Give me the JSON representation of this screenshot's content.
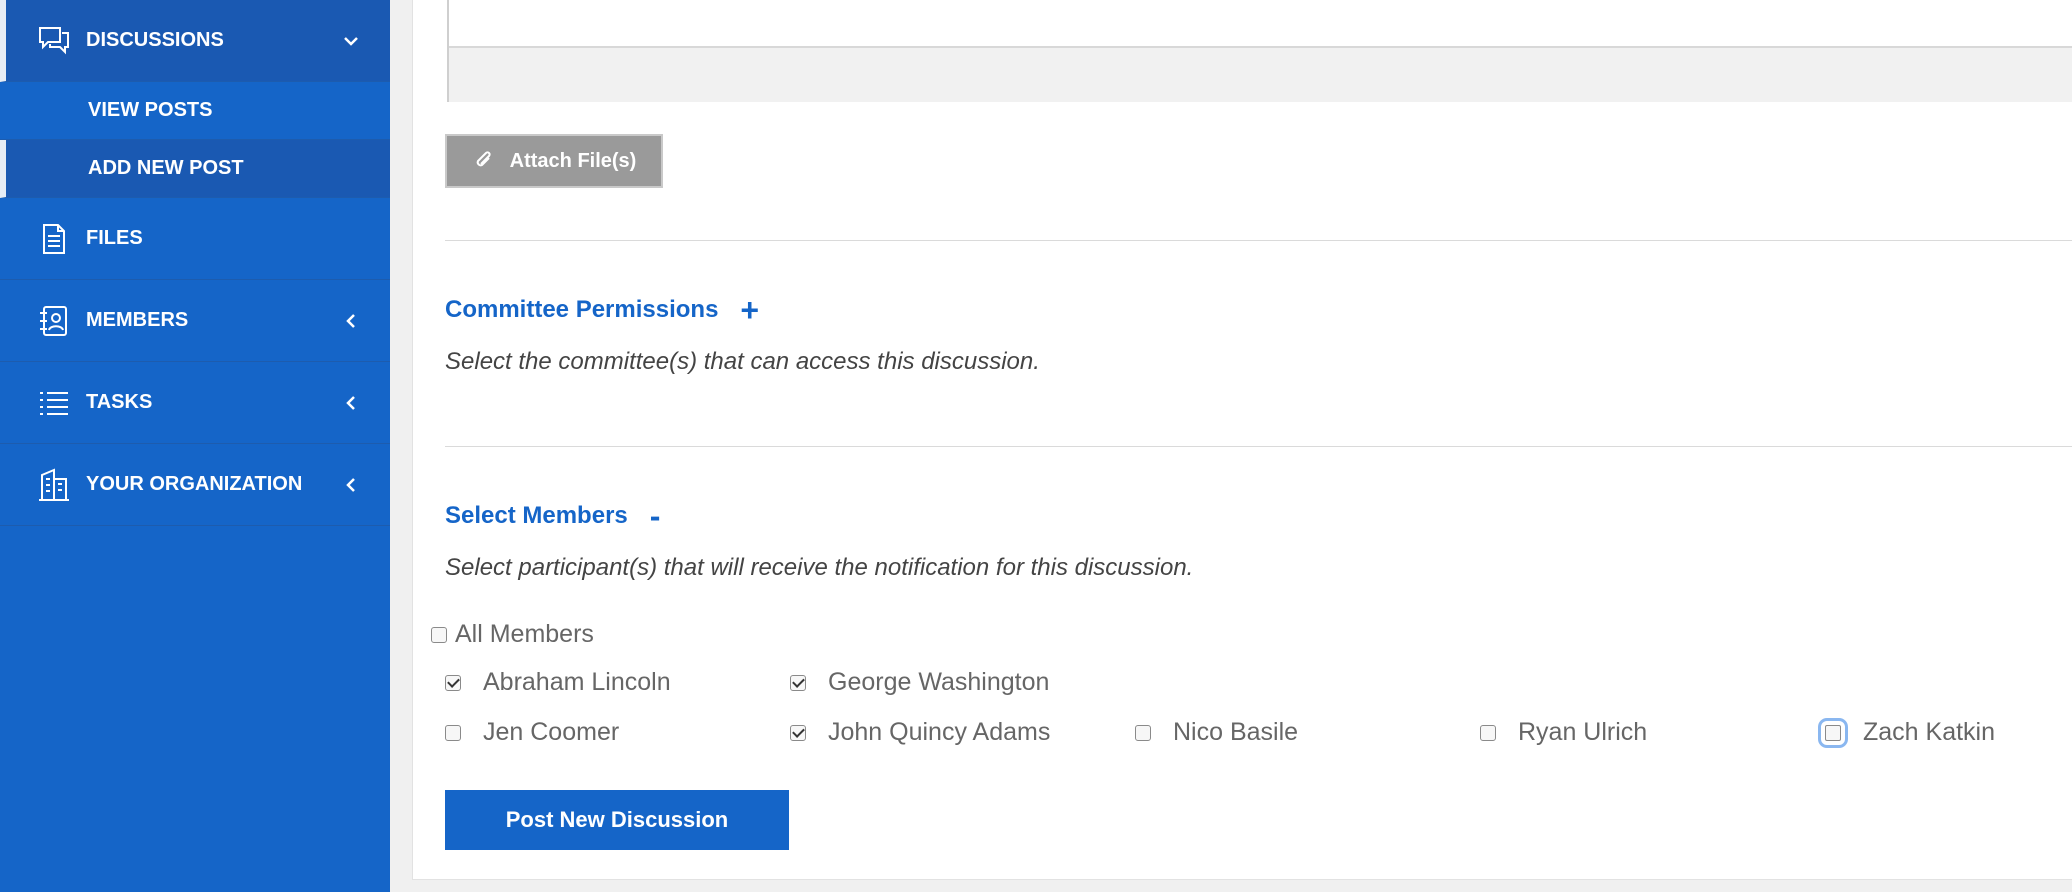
{
  "sidebar": {
    "items": [
      {
        "label": "DISCUSSIONS",
        "icon": "speech-bubble-icon",
        "expanded": true,
        "children": [
          {
            "label": "VIEW POSTS"
          },
          {
            "label": "ADD NEW POST"
          }
        ]
      },
      {
        "label": "FILES",
        "icon": "document-icon"
      },
      {
        "label": "MEMBERS",
        "icon": "address-book-icon"
      },
      {
        "label": "TASKS",
        "icon": "list-icon"
      },
      {
        "label": "YOUR ORGANIZATION",
        "icon": "building-icon"
      }
    ]
  },
  "form": {
    "attach_label": "Attach File(s)",
    "committee": {
      "title": "Committee Permissions",
      "toggle": "+",
      "help": "Select the committee(s) that can access this discussion."
    },
    "members": {
      "title": "Select Members",
      "toggle": "-",
      "help": "Select participant(s) that will receive the notification for this discussion.",
      "all_label": "All Members",
      "list": [
        {
          "name": "Abraham Lincoln",
          "checked": true
        },
        {
          "name": "George Washington",
          "checked": true
        },
        {
          "name": "Jen Coomer",
          "checked": false
        },
        {
          "name": "John Quincy Adams",
          "checked": true
        },
        {
          "name": "Nico Basile",
          "checked": false
        },
        {
          "name": "Ryan Ulrich",
          "checked": false
        },
        {
          "name": "Zach Katkin",
          "checked": false
        }
      ]
    },
    "submit_label": "Post New Discussion"
  },
  "colors": {
    "sidebar": "#1565c8",
    "accent": "#1565c8",
    "attach_button": "#9a9a9a"
  }
}
